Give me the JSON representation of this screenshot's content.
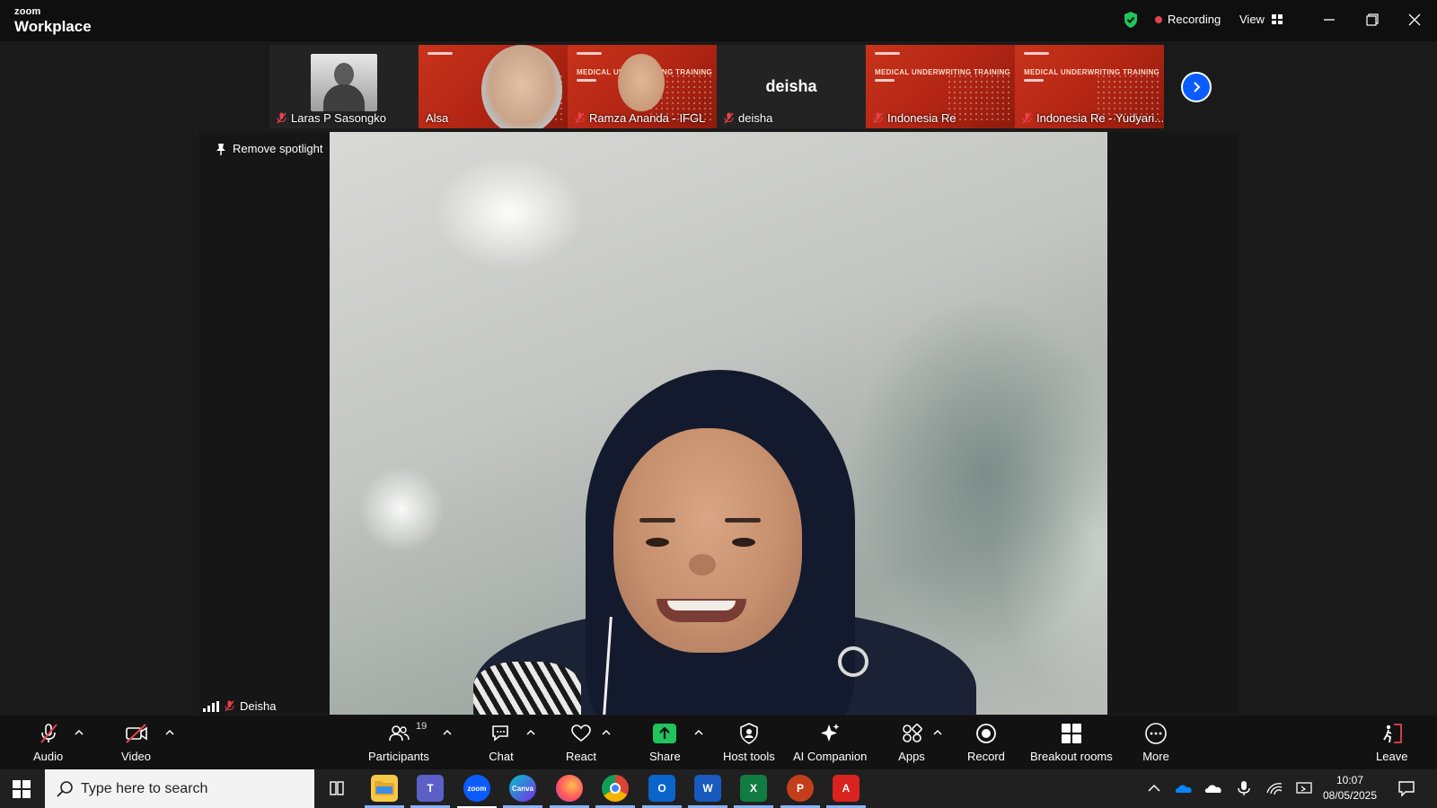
{
  "titlebar": {
    "brand_small": "zoom",
    "brand_big": "Workplace",
    "recording_label": "Recording",
    "view_label": "View"
  },
  "participants_strip": [
    {
      "name": "Laras P Sasongko",
      "muted": true
    },
    {
      "name": "Alsa",
      "muted": false
    },
    {
      "name": "Ramza Ananda - IFGL",
      "muted": true
    },
    {
      "name": "deisha",
      "muted": true,
      "display_text": "deisha"
    },
    {
      "name": "Indonesia Re",
      "muted": true
    },
    {
      "name": "Indonesia Re - Yudyari...",
      "muted": true
    }
  ],
  "banner_text": "MEDICAL UNDERWRITING TRAINING",
  "stage": {
    "spotlight_label": "Remove spotlight",
    "speaker_name": "Deisha"
  },
  "toolbar": {
    "audio": "Audio",
    "video": "Video",
    "participants": "Participants",
    "participants_count": "19",
    "chat": "Chat",
    "react": "React",
    "share": "Share",
    "host_tools": "Host tools",
    "ai_companion": "AI Companion",
    "apps": "Apps",
    "record": "Record",
    "breakout_rooms": "Breakout rooms",
    "more": "More",
    "leave": "Leave"
  },
  "taskbar": {
    "search_placeholder": "Type here to search",
    "time": "10:07",
    "date": "08/05/2025",
    "apps": [
      "task-view",
      "file-explorer",
      "teams",
      "zoom",
      "canva",
      "firefox",
      "chrome",
      "outlook",
      "word",
      "excel",
      "powerpoint",
      "acrobat"
    ]
  },
  "colors": {
    "accent_blue": "#0b5cff",
    "mute_red": "#e8414e",
    "share_green": "#21c35b",
    "banner_red": "#c8331b"
  }
}
